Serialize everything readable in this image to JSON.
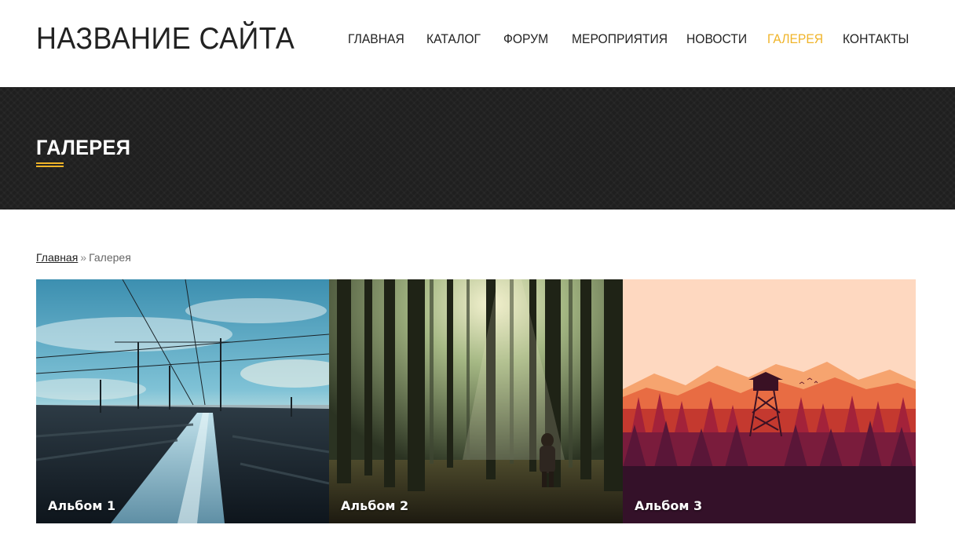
{
  "header": {
    "site_title": "НАЗВАНИЕ САЙТА",
    "nav": [
      {
        "label": "ГЛАВНАЯ",
        "active": false
      },
      {
        "label": "КАТАЛОГ",
        "active": false
      },
      {
        "label": "ФОРУМ",
        "active": false
      },
      {
        "label": "МЕРОПРИЯТИЯ",
        "active": false
      },
      {
        "label": "НОВОСТИ",
        "active": false
      },
      {
        "label": "ГАЛЕРЕЯ",
        "active": true
      },
      {
        "label": "КОНТАКТЫ",
        "active": false
      }
    ]
  },
  "banner": {
    "title": "ГАЛЕРЕЯ"
  },
  "breadcrumb": {
    "home": "Главная",
    "separator": "»",
    "current": "Галерея"
  },
  "gallery": {
    "albums": [
      {
        "label": "Альбом 1",
        "image": "railway-tracks-photo"
      },
      {
        "label": "Альбом 2",
        "image": "sunlit-forest-photo"
      },
      {
        "label": "Альбом 3",
        "image": "mountain-lookout-tower-illustration"
      }
    ]
  },
  "colors": {
    "accent": "#f0b429",
    "banner_bg": "#1f1f1f",
    "text": "#222222"
  }
}
